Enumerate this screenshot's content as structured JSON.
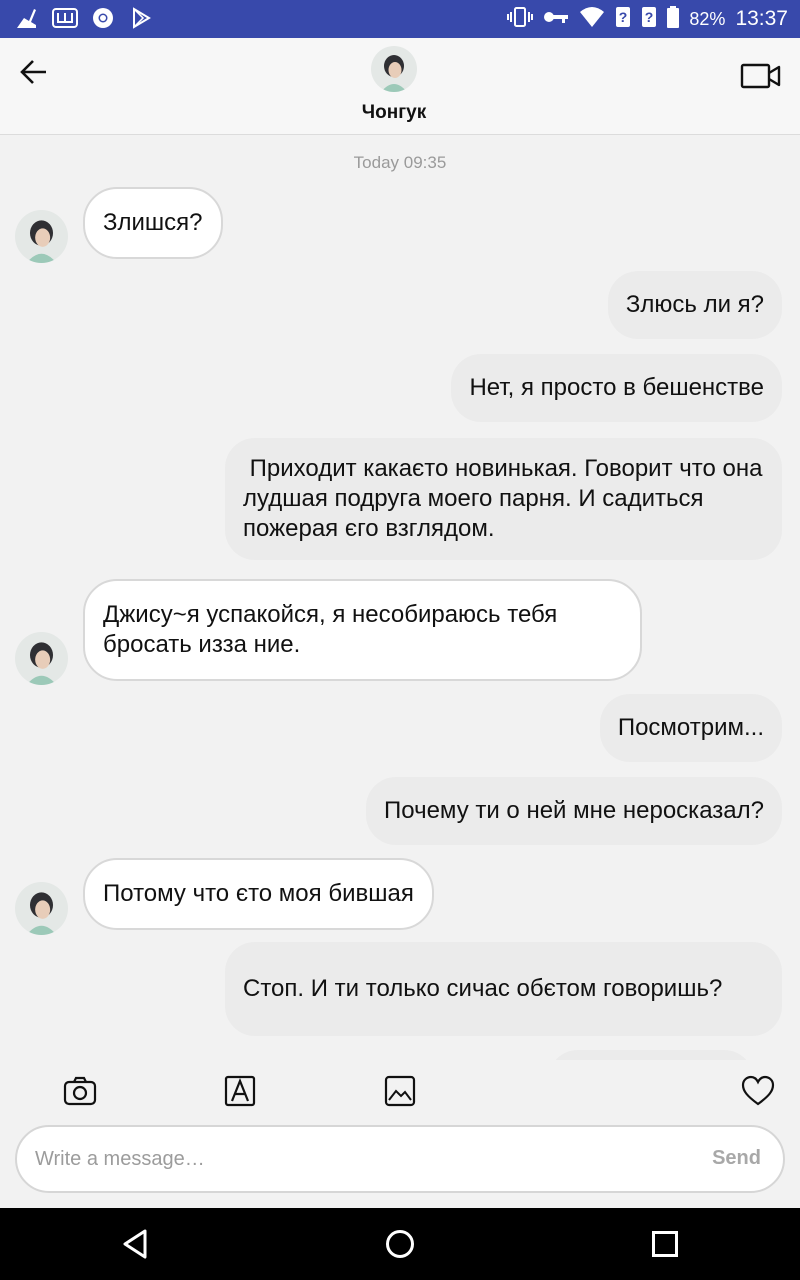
{
  "status_bar": {
    "battery": "82%",
    "time": "13:37",
    "left_icons": [
      "broom-icon",
      "w-app-icon",
      "chrome-icon",
      "play-store-icon"
    ],
    "right_icons": [
      "vibrate-icon",
      "key-icon",
      "wifi-icon",
      "no-signal-icon",
      "no-signal-icon",
      "battery-icon"
    ]
  },
  "header": {
    "contact_name": "Чонгук"
  },
  "chat": {
    "timestamp": "Today 09:35",
    "messages": [
      {
        "dir": "in",
        "text": "Злишся?"
      },
      {
        "dir": "out",
        "text": "Злюсь ли я?"
      },
      {
        "dir": "out",
        "text": "Нет, я просто в бешенстве"
      },
      {
        "dir": "out",
        "text": " Приходит какаєто новинькая. Говорит что она лудшая подруга моего парня. И садиться пожерая єго взглядом."
      },
      {
        "dir": "in",
        "text": "Джису~я успакойся, я несобираюсь тебя бросать изза ние."
      },
      {
        "dir": "out",
        "text": "Посмотрим..."
      },
      {
        "dir": "out",
        "text": "Почему ти о ней мне неросказал?"
      },
      {
        "dir": "in",
        "text": "Потому что єто моя бившая"
      },
      {
        "dir": "out",
        "text": "Стоп. И ти только сичас обєтом говоришь?"
      }
    ]
  },
  "toolbar": {
    "icons": [
      "camera-icon",
      "sticker-icon",
      "image-icon",
      "heart-icon"
    ]
  },
  "composer": {
    "placeholder": "Write a message…",
    "send_label": "Send"
  },
  "colors": {
    "status_bar": "#3849ab",
    "incoming_bubble": "#ffffff",
    "outgoing_bubble": "#ebebeb"
  }
}
